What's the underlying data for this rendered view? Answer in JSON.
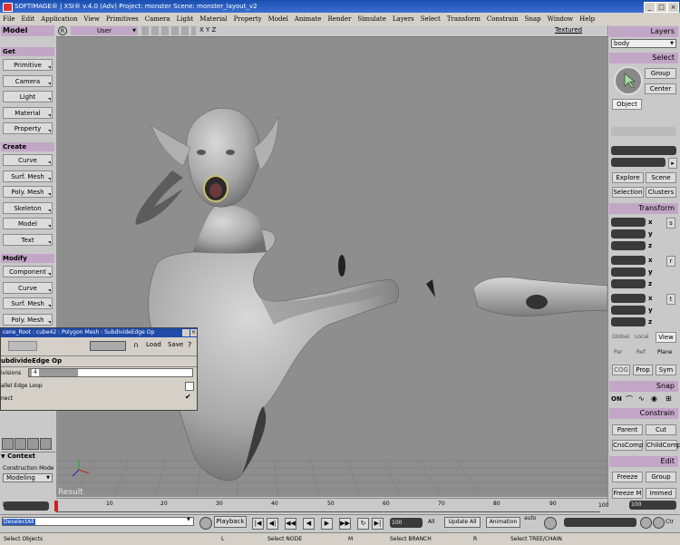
{
  "window": {
    "title": "SOFTIMAGE® | XSI® v.4.0 (Adv) Project: monster    Scene: monster_layout_v2"
  },
  "menu": [
    "File",
    "Edit",
    "Application",
    "View",
    "Primitives",
    "Camera",
    "Light",
    "Material",
    "Property",
    "Model",
    "Animate",
    "Render",
    "Simulate",
    "Layers",
    "Select",
    "Transform",
    "Constrain",
    "Snap",
    "Window",
    "Help"
  ],
  "left_panel": {
    "title": "Model",
    "get": {
      "label": "Get",
      "buttons": [
        "Primitive",
        "Camera",
        "Light",
        "Material",
        "Property"
      ]
    },
    "create": {
      "label": "Create",
      "buttons": [
        "Curve",
        "Surf. Mesh",
        "Poly. Mesh",
        "Skeleton",
        "Model",
        "Text"
      ]
    },
    "modify": {
      "label": "Modify",
      "buttons": [
        "Component",
        "Curve",
        "Surf. Mesh",
        "Poly. Mesh"
      ]
    },
    "context_label": "Context",
    "construction_mode_label": "Construction Mode",
    "construction_mode_value": "Modeling"
  },
  "viewport": {
    "camera": "User",
    "axes": "X Y Z",
    "shading": "Textured",
    "result_label": "Result"
  },
  "property_editor": {
    "path": "cene_Root : cube42 : Polygon Mesh : SubdivideEdge Op",
    "load_label": "Load",
    "save_label": "Save",
    "help_label": "?",
    "op_name": "ubdivideEdge Op",
    "divisions_label": "ivisions",
    "divisions_value": "4",
    "divisions_fraction": 0.3,
    "parallel_label": "allel Edge Loop",
    "connect_label": "nect"
  },
  "right_panel": {
    "layers_title": "Layers",
    "layer_value": "body",
    "select_title": "Select",
    "group_label": "Group",
    "center_label": "Center",
    "object_label": "Object",
    "explore_label": "Explore",
    "scene_label": "Scene",
    "selection_label": "Selection",
    "clusters_label": "Clusters",
    "transform_title": "Transform",
    "axes": [
      "x",
      "y",
      "z"
    ],
    "scale_label": "s",
    "rotate_label": "r",
    "translate_label": "t",
    "global_label": "Global",
    "local_label": "Local",
    "view_label": "View",
    "par_label": "Par",
    "ref_label": "Ref",
    "plane_label": "Plane",
    "cog_label": "COG",
    "prop_label": "Prop",
    "sym_label": "Sym",
    "snap_title": "Snap",
    "on_label": "ON",
    "constrain_title": "Constrain",
    "parent_label": "Parent",
    "cut_label": "Cut",
    "cnscomp_label": "CnsComp",
    "childcomp_label": "ChildComp",
    "edit_title": "Edit",
    "freeze_label": "Freeze",
    "group2_label": "Group",
    "freezem_label": "Freeze M",
    "immed_label": "Immed"
  },
  "timeline": {
    "start": "1",
    "end": "100",
    "ticks": [
      "10",
      "20",
      "30",
      "40",
      "50",
      "60",
      "70",
      "80",
      "90"
    ],
    "end_field": "100"
  },
  "command_bar": {
    "command_text": "DeselectAll",
    "playback_label": "Playback",
    "frame_value": "100",
    "all_label": "All",
    "update_all_label": "Update All",
    "animation_label": "Animation",
    "auto_label": "auto",
    "ctrl_label": "Ctr"
  },
  "status_bar": {
    "left": "Select Objects",
    "l_key": "L",
    "node": "Select NODE",
    "m_key": "M",
    "branch": "Select BRANCH",
    "r_key": "R",
    "tree": "Select TREE/CHAIN"
  }
}
